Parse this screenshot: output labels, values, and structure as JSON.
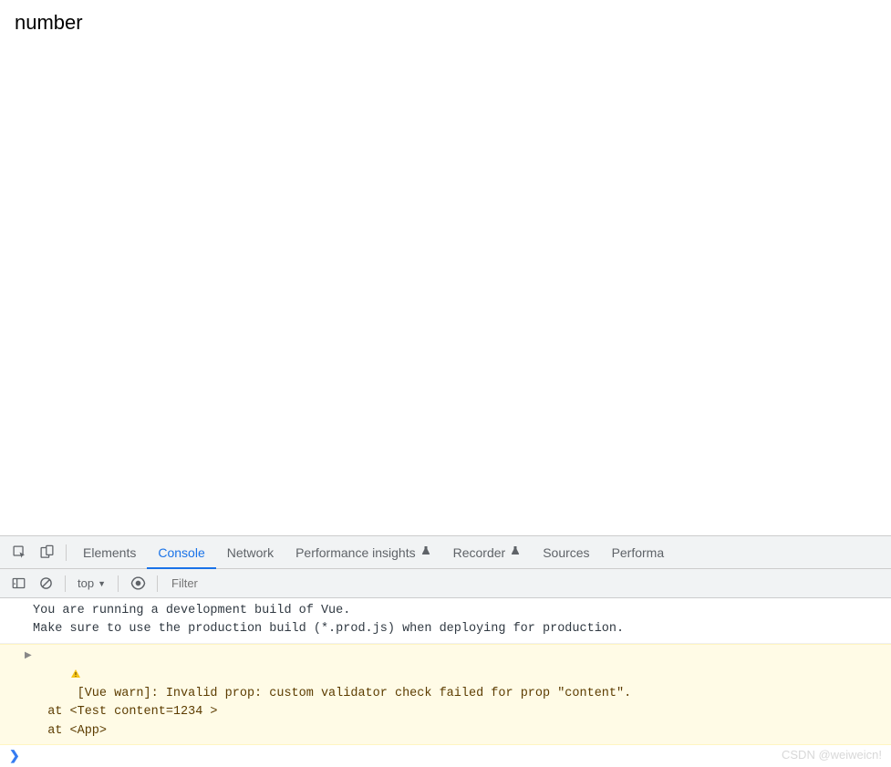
{
  "page_content": "number",
  "tabs": {
    "elements": "Elements",
    "console": "Console",
    "network": "Network",
    "performance_insights": "Performance insights",
    "recorder": "Recorder",
    "sources": "Sources",
    "performance": "Performa"
  },
  "toolbar": {
    "context": "top",
    "filter_placeholder": "Filter"
  },
  "console": {
    "info_line1": "You are running a development build of Vue.",
    "info_line2": "Make sure to use the production build (*.prod.js) when deploying for production.",
    "warn_line1": "[Vue warn]: Invalid prop: custom validator check failed for prop \"content\". ",
    "warn_line2": "  at <Test content=1234 > ",
    "warn_line3": "  at <App>",
    "prompt": "❯"
  },
  "watermark": "CSDN @weiweicn!"
}
